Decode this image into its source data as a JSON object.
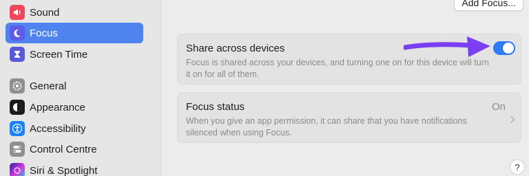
{
  "sidebar": {
    "items": [
      {
        "label": "Sound",
        "icon": "speaker-icon",
        "active": false
      },
      {
        "label": "Focus",
        "icon": "moon-icon",
        "active": true
      },
      {
        "label": "Screen Time",
        "icon": "hourglass-icon",
        "active": false
      },
      {
        "label": "General",
        "icon": "gear-icon",
        "active": false
      },
      {
        "label": "Appearance",
        "icon": "appearance-icon",
        "active": false
      },
      {
        "label": "Accessibility",
        "icon": "accessibility-icon",
        "active": false
      },
      {
        "label": "Control Centre",
        "icon": "toggles-icon",
        "active": false
      },
      {
        "label": "Siri & Spotlight",
        "icon": "siri-icon",
        "active": false
      }
    ]
  },
  "main": {
    "add_focus_label": "Add Focus...",
    "share": {
      "title": "Share across devices",
      "description": "Focus is shared across your devices, and turning one on for this device will turn it on for all of them.",
      "toggle_on": true
    },
    "status": {
      "title": "Focus status",
      "value": "On",
      "description": "When you give an app permission, it can share that you have notifications silenced when using Focus."
    },
    "help_label": "?"
  },
  "colors": {
    "accent": "#4f84ee",
    "toggle": "#2f7bf6",
    "annotation_arrow": "#7b3ff2"
  }
}
